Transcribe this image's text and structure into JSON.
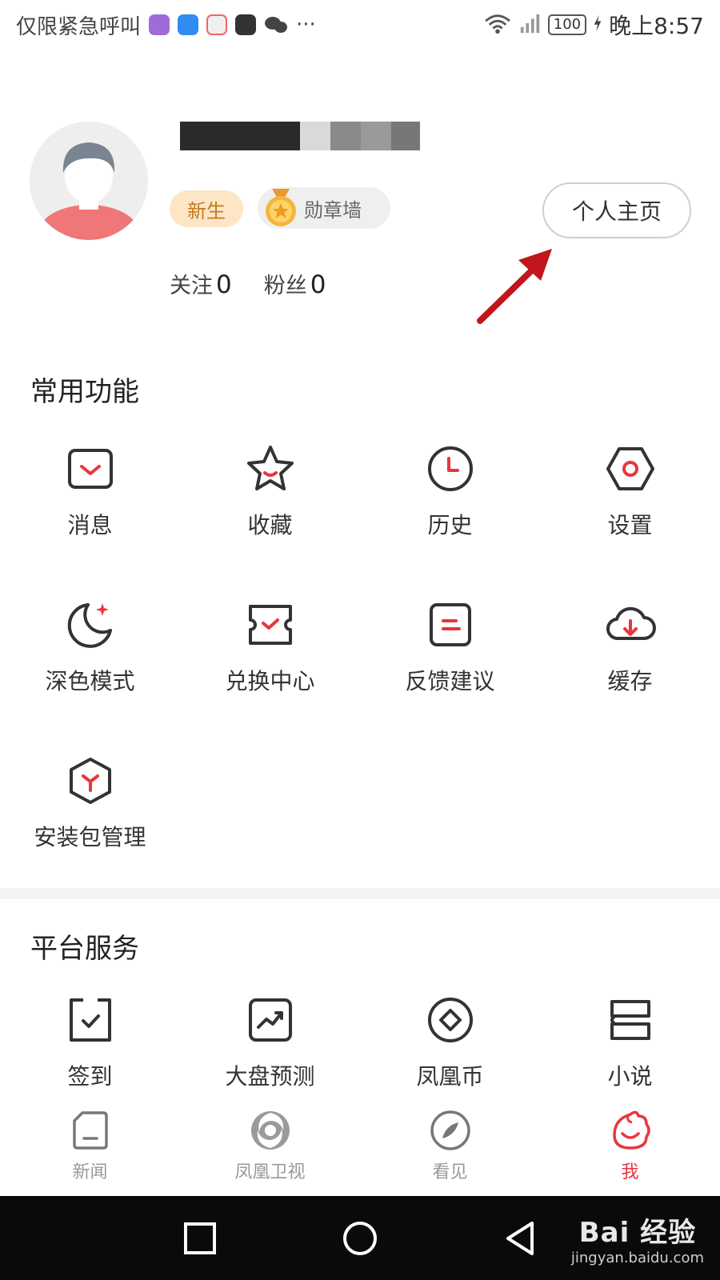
{
  "status_bar": {
    "left_text": "仅限紧急呼叫",
    "more": "···",
    "battery": "100",
    "time": "晚上8:57"
  },
  "profile": {
    "badge_new": "新生",
    "badge_medal": "勋章墙",
    "homepage_button": "个人主页",
    "follow_label": "关注",
    "follow_count": "0",
    "fans_label": "粉丝",
    "fans_count": "0"
  },
  "sections": {
    "common": {
      "title": "常用功能",
      "items": [
        {
          "label": "消息",
          "icon": "message-icon"
        },
        {
          "label": "收藏",
          "icon": "star-icon"
        },
        {
          "label": "历史",
          "icon": "clock-icon"
        },
        {
          "label": "设置",
          "icon": "settings-icon"
        },
        {
          "label": "深色模式",
          "icon": "moon-icon"
        },
        {
          "label": "兑换中心",
          "icon": "ticket-icon"
        },
        {
          "label": "反馈建议",
          "icon": "feedback-icon"
        },
        {
          "label": "缓存",
          "icon": "cloud-download-icon"
        },
        {
          "label": "安装包管理",
          "icon": "package-icon"
        }
      ]
    },
    "platform": {
      "title": "平台服务",
      "items": [
        {
          "label": "签到",
          "icon": "checkin-icon"
        },
        {
          "label": "大盘预测",
          "icon": "chart-trend-icon"
        },
        {
          "label": "凤凰币",
          "icon": "coin-icon"
        },
        {
          "label": "小说",
          "icon": "book-icon"
        }
      ]
    }
  },
  "tabs": [
    {
      "label": "新闻",
      "icon": "news-icon",
      "active": false
    },
    {
      "label": "凤凰卫视",
      "icon": "phoenix-tv-icon",
      "active": false
    },
    {
      "label": "看见",
      "icon": "compass-icon",
      "active": false
    },
    {
      "label": "我",
      "icon": "me-icon",
      "active": true
    }
  ],
  "watermark": {
    "main": "Bai 经验",
    "sub": "jingyan.baidu.com"
  },
  "colors": {
    "accent": "#e8363c",
    "icon_stroke": "#333333",
    "badge_new_bg": "#fde6c6",
    "badge_new_text": "#c37a1e",
    "arrow": "#c0161c"
  }
}
